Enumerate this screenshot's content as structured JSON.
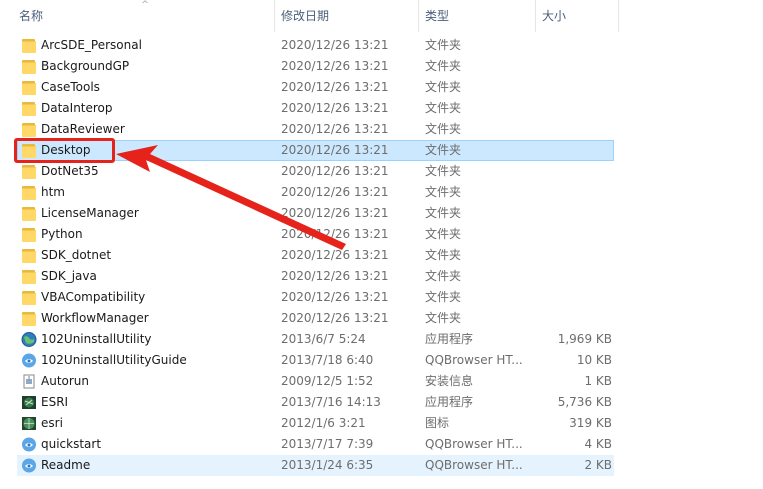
{
  "header": {
    "name": "名称",
    "date": "修改日期",
    "type": "类型",
    "size": "大小",
    "sort_indicator": "^"
  },
  "files": [
    {
      "name": "ArcSDE_Personal",
      "date": "2020/12/26 13:21",
      "type": "文件夹",
      "size": "",
      "icon": "folder-icon"
    },
    {
      "name": "BackgroundGP",
      "date": "2020/12/26 13:21",
      "type": "文件夹",
      "size": "",
      "icon": "folder-icon"
    },
    {
      "name": "CaseTools",
      "date": "2020/12/26 13:21",
      "type": "文件夹",
      "size": "",
      "icon": "folder-icon"
    },
    {
      "name": "DataInterop",
      "date": "2020/12/26 13:21",
      "type": "文件夹",
      "size": "",
      "icon": "folder-icon"
    },
    {
      "name": "DataReviewer",
      "date": "2020/12/26 13:21",
      "type": "文件夹",
      "size": "",
      "icon": "folder-icon"
    },
    {
      "name": "Desktop",
      "date": "2020/12/26 13:21",
      "type": "文件夹",
      "size": "",
      "icon": "folder-icon",
      "state": "selected"
    },
    {
      "name": "DotNet35",
      "date": "2020/12/26 13:21",
      "type": "文件夹",
      "size": "",
      "icon": "folder-icon"
    },
    {
      "name": "htm",
      "date": "2020/12/26 13:21",
      "type": "文件夹",
      "size": "",
      "icon": "folder-icon"
    },
    {
      "name": "LicenseManager",
      "date": "2020/12/26 13:21",
      "type": "文件夹",
      "size": "",
      "icon": "folder-icon"
    },
    {
      "name": "Python",
      "date": "2020/12/26 13:21",
      "type": "文件夹",
      "size": "",
      "icon": "folder-icon"
    },
    {
      "name": "SDK_dotnet",
      "date": "2020/12/26 13:21",
      "type": "文件夹",
      "size": "",
      "icon": "folder-icon"
    },
    {
      "name": "SDK_java",
      "date": "2020/12/26 13:21",
      "type": "文件夹",
      "size": "",
      "icon": "folder-icon"
    },
    {
      "name": "VBACompatibility",
      "date": "2020/12/26 13:21",
      "type": "文件夹",
      "size": "",
      "icon": "folder-icon"
    },
    {
      "name": "WorkflowManager",
      "date": "2020/12/26 13:21",
      "type": "文件夹",
      "size": "",
      "icon": "folder-icon"
    },
    {
      "name": "102UninstallUtility",
      "date": "2013/6/7 5:24",
      "type": "应用程序",
      "size": "1,969 KB",
      "icon": "globe-app-icon"
    },
    {
      "name": "102UninstallUtilityGuide",
      "date": "2013/7/18 6:40",
      "type": "QQBrowser HT...",
      "size": "10 KB",
      "icon": "browser-document-icon"
    },
    {
      "name": "Autorun",
      "date": "2009/12/5 1:52",
      "type": "安装信息",
      "size": "1 KB",
      "icon": "setup-info-icon"
    },
    {
      "name": "ESRI",
      "date": "2013/7/16 14:13",
      "type": "应用程序",
      "size": "5,736 KB",
      "icon": "esri-app-icon"
    },
    {
      "name": "esri",
      "date": "2012/1/6 3:21",
      "type": "图标",
      "size": "319 KB",
      "icon": "esri-globe-icon"
    },
    {
      "name": "quickstart",
      "date": "2013/7/17 7:39",
      "type": "QQBrowser HT...",
      "size": "4 KB",
      "icon": "browser-document-icon"
    },
    {
      "name": "Readme",
      "date": "2013/1/24 6:35",
      "type": "QQBrowser HT...",
      "size": "2 KB",
      "icon": "browser-document-icon",
      "state": "hovered"
    }
  ],
  "colors": {
    "selection_bg": "#cce8ff",
    "selection_border": "#99d1ff",
    "hover_bg": "#e5f3ff",
    "annotation_red": "#e5231b",
    "folder_yellow": "#ffd867"
  }
}
